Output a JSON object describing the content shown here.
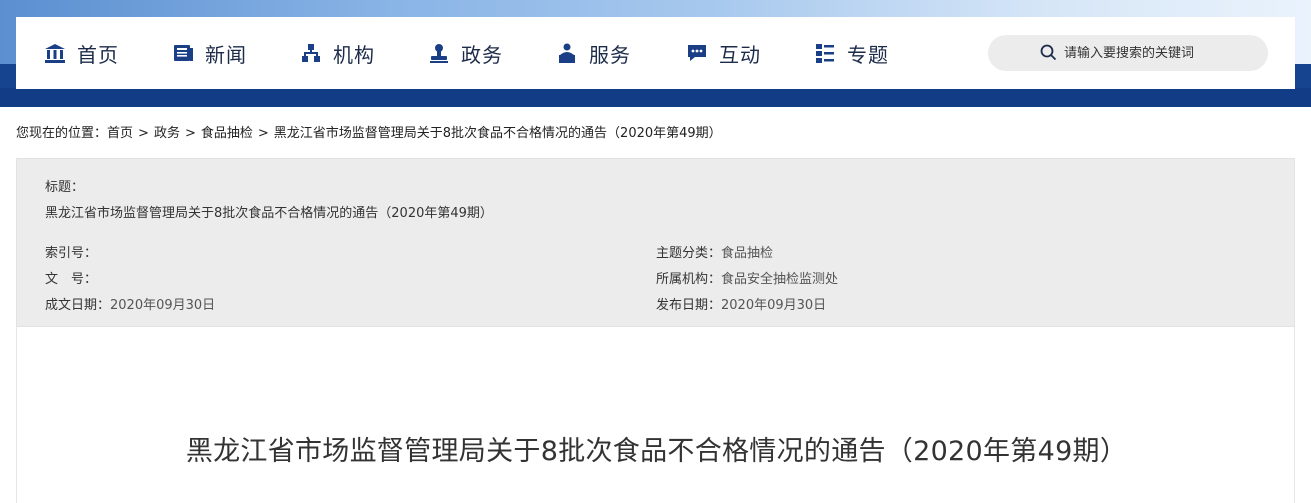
{
  "nav": {
    "items": [
      {
        "label": "首页",
        "icon": "building-icon"
      },
      {
        "label": "新闻",
        "icon": "newspaper-icon"
      },
      {
        "label": "机构",
        "icon": "org-chart-icon"
      },
      {
        "label": "政务",
        "icon": "stamp-icon"
      },
      {
        "label": "服务",
        "icon": "person-service-icon"
      },
      {
        "label": "互动",
        "icon": "chat-icon"
      },
      {
        "label": "专题",
        "icon": "topic-grid-icon"
      }
    ],
    "search_placeholder": "请输入要搜索的关键词"
  },
  "breadcrumb": {
    "prefix": "您现在的位置：",
    "items": [
      "首页",
      "政务",
      "食品抽检",
      "黑龙江省市场监督管理局关于8批次食品不合格情况的通告（2020年第49期）"
    ],
    "separator": ">"
  },
  "info": {
    "title_label": "标题：",
    "title_value": "黑龙江省市场监督管理局关于8批次食品不合格情况的通告（2020年第49期）",
    "index_label": "索引号：",
    "index_value": "",
    "doc_label": "文　号：",
    "doc_value": "",
    "date_written_label": "成文日期：",
    "date_written_value": "2020年09月30日",
    "category_label": "主题分类：",
    "category_value": "食品抽检",
    "org_label": "所属机构：",
    "org_value": "食品安全抽检监测处",
    "publish_label": "发布日期：",
    "publish_value": "2020年09月30日"
  },
  "article": {
    "title": "黑龙江省市场监督管理局关于8批次食品不合格情况的通告（2020年第49期）"
  },
  "colors": {
    "header_blue": "#16448f",
    "nav_text": "#1c2b4a",
    "icon_blue": "#1a3f86",
    "info_bg": "#ececec"
  }
}
